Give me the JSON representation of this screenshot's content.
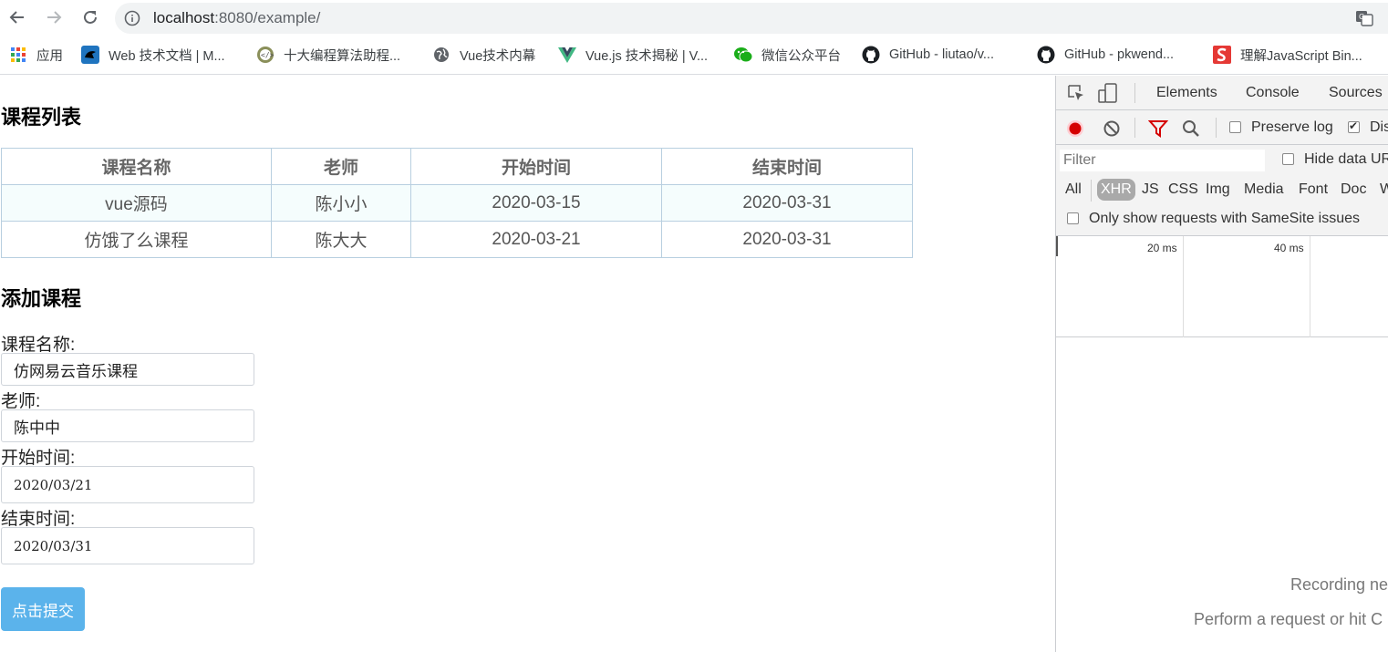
{
  "browser": {
    "url_host": "localhost",
    "url_rest": ":8080/example/",
    "bookmarks": [
      {
        "label": "应用",
        "icon": "apps-grid-icon"
      },
      {
        "label": "Web 技术文档 | M...",
        "icon": "mdn-icon"
      },
      {
        "label": "十大编程算法助程...",
        "icon": "code-badge-icon"
      },
      {
        "label": "Vue技术内幕",
        "icon": "globe-icon"
      },
      {
        "label": "Vue.js 技术揭秘 | V...",
        "icon": "vue-icon"
      },
      {
        "label": "微信公众平台",
        "icon": "wechat-icon"
      },
      {
        "label": "GitHub - liutao/v...",
        "icon": "github-icon"
      },
      {
        "label": "GitHub - pkwend...",
        "icon": "github-icon"
      },
      {
        "label": "理解JavaScript Bin...",
        "icon": "s-logo-icon"
      }
    ]
  },
  "page": {
    "list_title": "课程列表",
    "add_title": "添加课程",
    "table": {
      "headers": [
        "课程名称",
        "老师",
        "开始时间",
        "结束时间"
      ],
      "rows": [
        [
          "vue源码",
          "陈小小",
          "2020-03-15",
          "2020-03-31"
        ],
        [
          "仿饿了么课程",
          "陈大大",
          "2020-03-21",
          "2020-03-31"
        ]
      ]
    },
    "form": {
      "name_label": "课程名称:",
      "name_value": "仿网易云音乐课程",
      "teacher_label": "老师:",
      "teacher_value": "陈中中",
      "start_label": "开始时间:",
      "start_value": "2020/03/21",
      "end_label": "结束时间:",
      "end_value": "2020/03/31",
      "submit_label": "点击提交"
    }
  },
  "devtools": {
    "tabs": [
      "Elements",
      "Console",
      "Sources"
    ],
    "preserve_log": "Preserve log",
    "disable_cache": "Dis",
    "filter_placeholder": "Filter",
    "hide_data_urls": "Hide data UR",
    "types": [
      "All",
      "XHR",
      "JS",
      "CSS",
      "Img",
      "Media",
      "Font",
      "Doc",
      "W"
    ],
    "samesite": "Only show requests with SameSite issues",
    "ticks": [
      "20 ms",
      "40 ms"
    ],
    "empty_line1": "Recording ne",
    "empty_line2": "Perform a request or hit C",
    "record_color": "#d50000",
    "filter_color": "#d50000"
  }
}
